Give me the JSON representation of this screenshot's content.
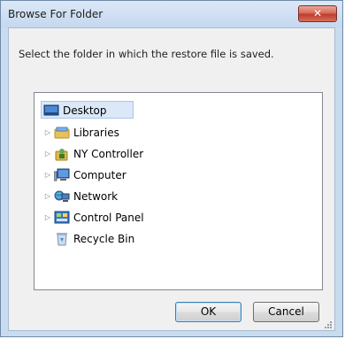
{
  "window": {
    "title": "Browse For Folder",
    "close_symbol": "✕"
  },
  "dialog": {
    "prompt": "Select the folder in which the restore file is saved."
  },
  "tree": {
    "items": [
      {
        "label": "Desktop",
        "icon": "desktop-icon",
        "selected": true
      },
      {
        "label": "Libraries",
        "icon": "libraries-icon"
      },
      {
        "label": "NY Controller",
        "icon": "user-folder-icon"
      },
      {
        "label": "Computer",
        "icon": "computer-icon"
      },
      {
        "label": "Network",
        "icon": "network-icon"
      },
      {
        "label": "Control Panel",
        "icon": "control-panel-icon"
      },
      {
        "label": "Recycle Bin",
        "icon": "recycle-bin-icon"
      }
    ]
  },
  "buttons": {
    "ok": "OK",
    "cancel": "Cancel"
  },
  "colors": {
    "selection_bg": "#dbe8f8",
    "close_red": "#c7412f",
    "frame": "#c9dbee"
  }
}
